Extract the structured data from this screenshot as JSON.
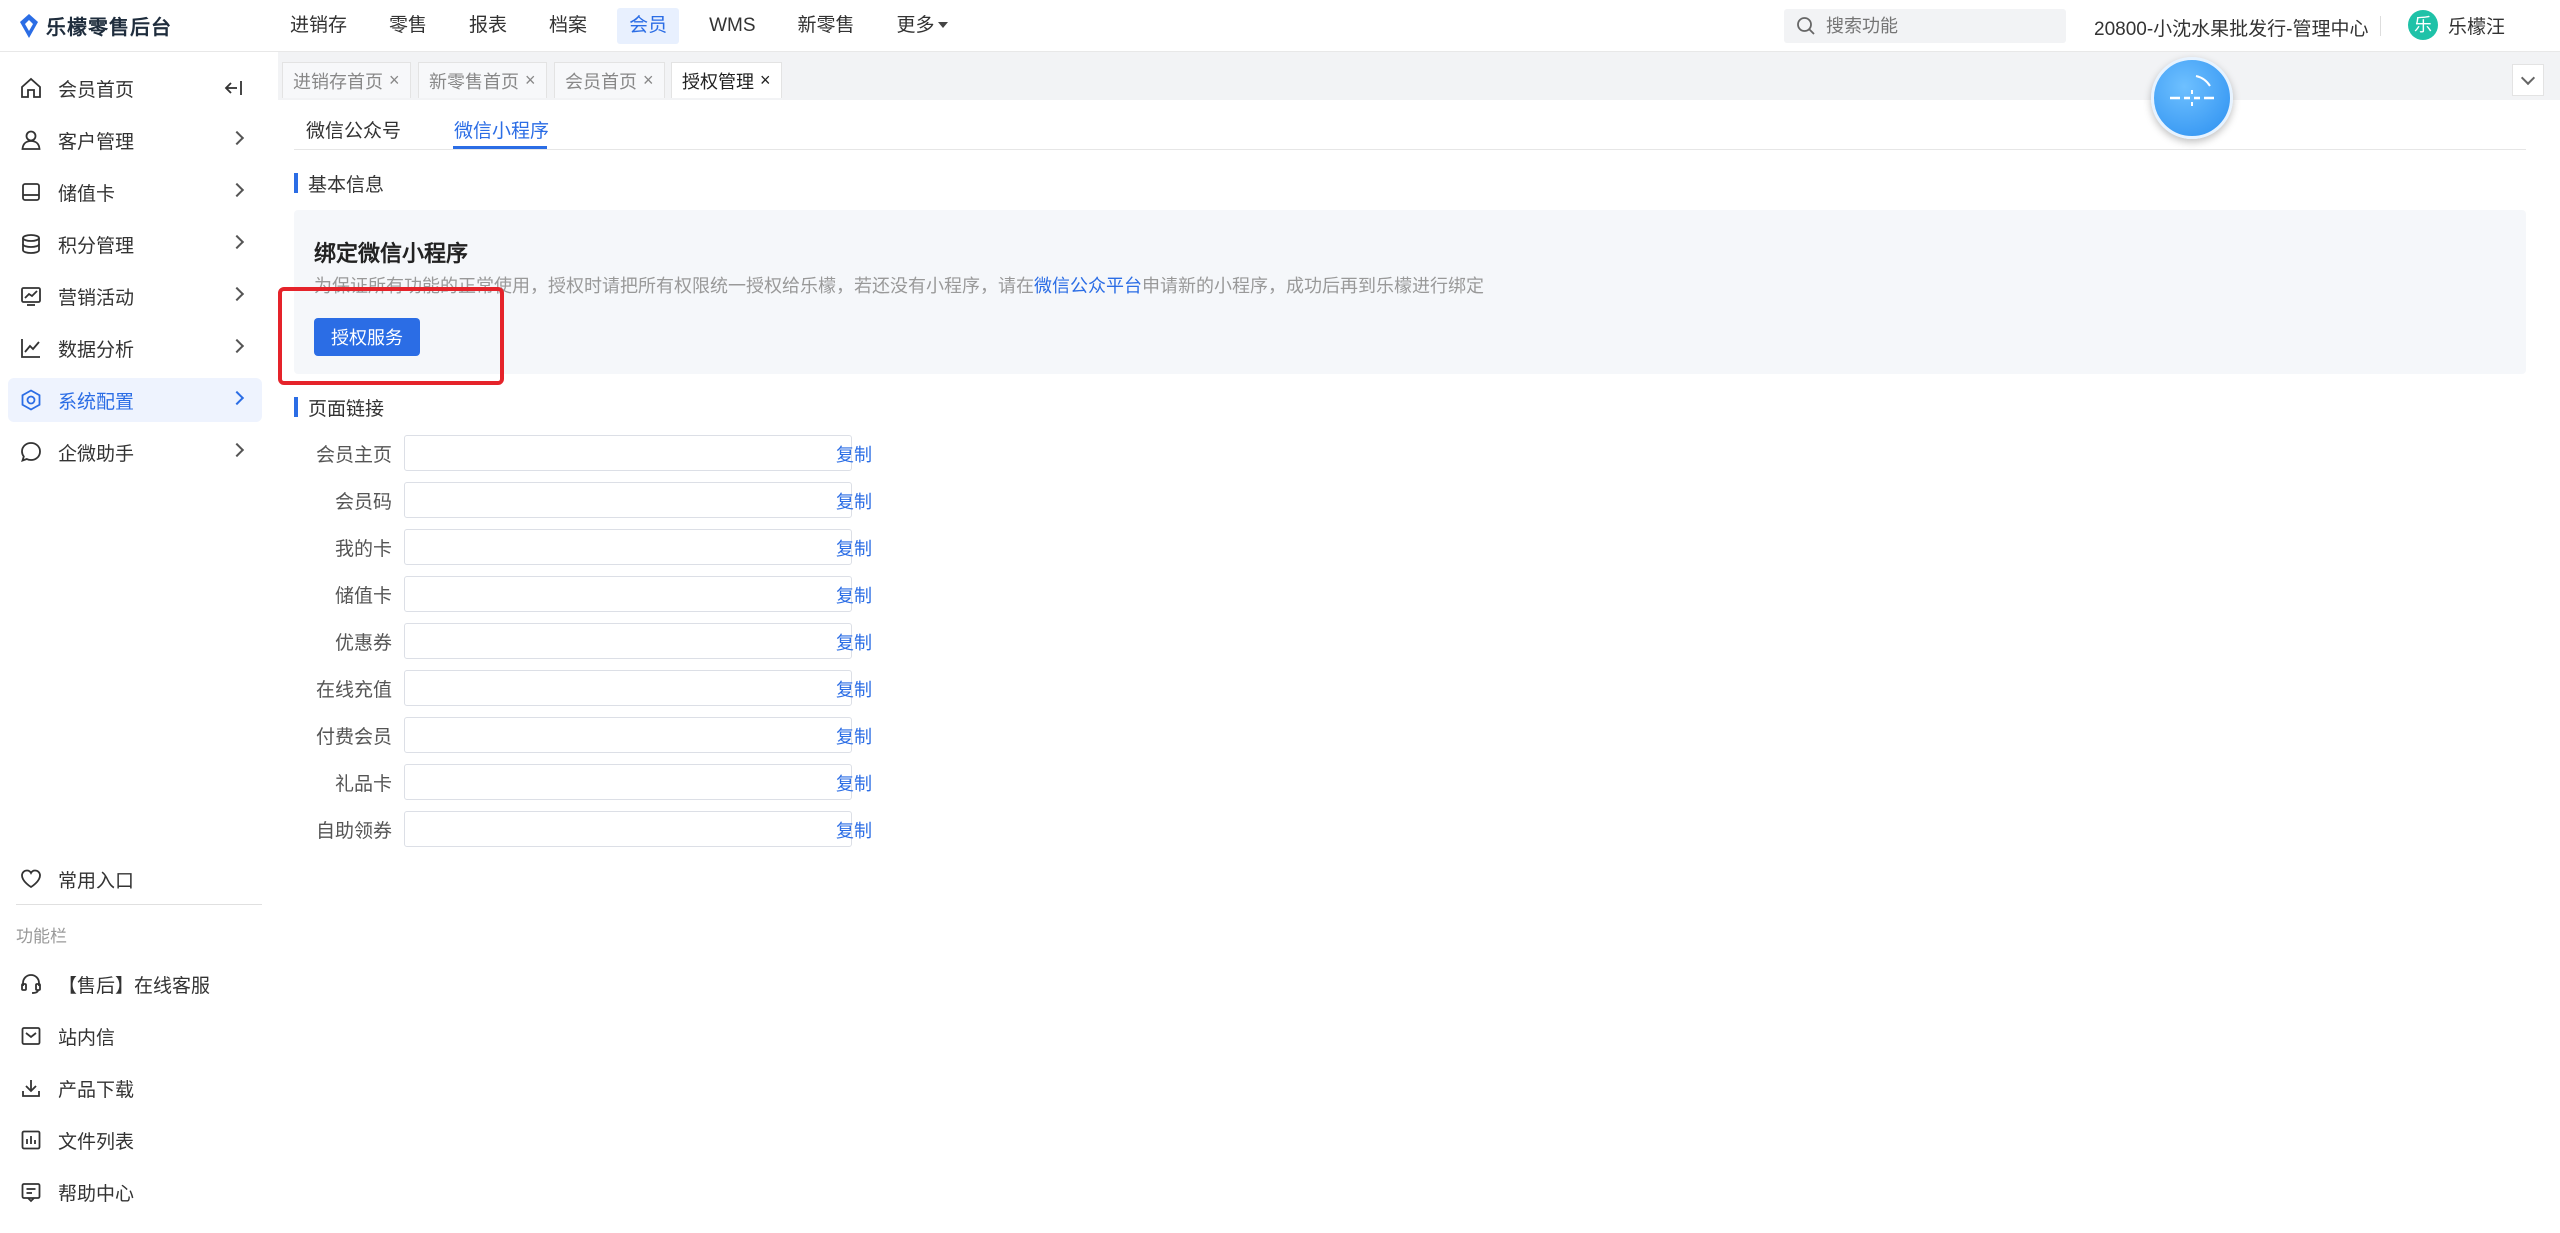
{
  "app": {
    "logo_text": "乐檬零售后台"
  },
  "nav": {
    "items": [
      {
        "label": "进销存",
        "active": false
      },
      {
        "label": "零售",
        "active": false
      },
      {
        "label": "报表",
        "active": false
      },
      {
        "label": "档案",
        "active": false
      },
      {
        "label": "会员",
        "active": true
      },
      {
        "label": "WMS",
        "active": false
      },
      {
        "label": "新零售",
        "active": false
      },
      {
        "label": "更多",
        "active": false
      }
    ]
  },
  "search": {
    "placeholder": "搜索功能"
  },
  "store_name": "20800-小沈水果批发行-管理中心",
  "user": {
    "avatar_text": "乐",
    "name": "乐檬汪"
  },
  "sidebar": {
    "items": [
      {
        "label": "会员首页",
        "icon": "home-icon"
      },
      {
        "label": "客户管理",
        "icon": "user-icon"
      },
      {
        "label": "储值卡",
        "icon": "card-icon"
      },
      {
        "label": "积分管理",
        "icon": "database-icon"
      },
      {
        "label": "营销活动",
        "icon": "chart-screen-icon"
      },
      {
        "label": "数据分析",
        "icon": "line-chart-icon"
      },
      {
        "label": "系统配置",
        "icon": "settings-icon",
        "active": true
      },
      {
        "label": "企微助手",
        "icon": "chat-icon"
      }
    ],
    "favorites_label": "常用入口",
    "section_label": "功能栏",
    "tools": [
      {
        "label": "【售后】在线客服",
        "icon": "headset-icon"
      },
      {
        "label": "站内信",
        "icon": "mail-icon"
      },
      {
        "label": "产品下载",
        "icon": "download-icon"
      },
      {
        "label": "文件列表",
        "icon": "file-list-icon"
      },
      {
        "label": "帮助中心",
        "icon": "help-icon"
      }
    ]
  },
  "tabs": [
    {
      "label": "进销存首页",
      "active": false
    },
    {
      "label": "新零售首页",
      "active": false
    },
    {
      "label": "会员首页",
      "active": false
    },
    {
      "label": "授权管理",
      "active": true
    }
  ],
  "subtabs": [
    {
      "label": "微信公众号",
      "active": false
    },
    {
      "label": "微信小程序",
      "active": true
    }
  ],
  "basic_info": {
    "title": "基本信息",
    "bind_title": "绑定微信小程序",
    "desc_before": "为保证所有功能的正常使用，授权时请把所有权限统一授权给乐檬，若还没有小程序，请在",
    "desc_link": "微信公众平台",
    "desc_after": "申请新的小程序，成功后再到乐檬进行绑定",
    "auth_button": "授权服务"
  },
  "page_links": {
    "title": "页面链接",
    "copy_label": "复制",
    "rows": [
      {
        "label": "会员主页",
        "value": ""
      },
      {
        "label": "会员码",
        "value": ""
      },
      {
        "label": "我的卡",
        "value": ""
      },
      {
        "label": "储值卡",
        "value": ""
      },
      {
        "label": "优惠券",
        "value": ""
      },
      {
        "label": "在线充值",
        "value": ""
      },
      {
        "label": "付费会员",
        "value": ""
      },
      {
        "label": "礼品卡",
        "value": ""
      },
      {
        "label": "自助领券",
        "value": ""
      }
    ]
  }
}
